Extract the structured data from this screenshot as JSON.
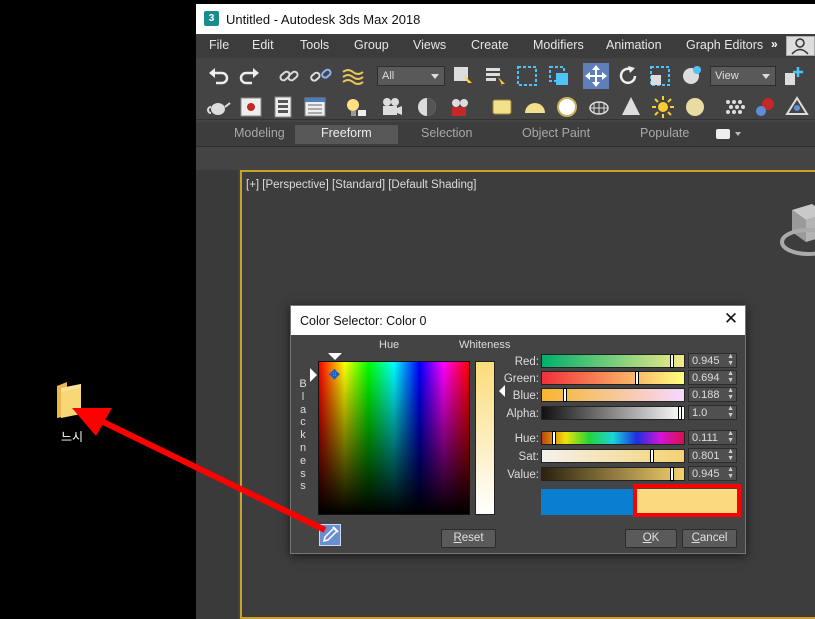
{
  "desktop": {
    "folder_label": "느시"
  },
  "window": {
    "logo": "3",
    "title": "Untitled - Autodesk 3ds Max 2018"
  },
  "menu": {
    "items": [
      "File",
      "Edit",
      "Tools",
      "Group",
      "Views",
      "Create",
      "Modifiers",
      "Animation",
      "Graph Editors"
    ],
    "more": "»"
  },
  "toolbar": {
    "selection_filter": "All",
    "coord_system": "View",
    "icons_row1": [
      "undo-icon",
      "redo-icon",
      "link-icon",
      "unlink-icon",
      "bind-space-warp-icon",
      "select-object-icon",
      "select-by-name-icon",
      "rectangular-selection-icon",
      "window-crossing-icon",
      "move-icon",
      "rotate-icon",
      "scale-icon",
      "placement-icon"
    ],
    "icons_row2": [
      "teapot-icon",
      "render-frame-icon",
      "material-editor-icon",
      "schematic-icon",
      "light-lister-icon",
      "camera-icon",
      "render-icon",
      "render-setup-icon",
      "box-icon",
      "sphere-icon",
      "cylinder-icon",
      "torus-icon",
      "cone-icon",
      "sun-icon",
      "geosphere-icon",
      "particle-icon",
      "atom-icon",
      "helper-icon"
    ]
  },
  "ribbon": {
    "tabs": [
      "Modeling",
      "Freeform",
      "Selection",
      "Object Paint",
      "Populate"
    ],
    "active_tab": "Freeform"
  },
  "viewport": {
    "label": "[+] [Perspective] [Standard] [Default Shading]"
  },
  "color_selector": {
    "title": "Color Selector: Color 0",
    "hue_label": "Hue",
    "whiteness_label": "Whiteness",
    "blackness_label": [
      "B",
      "l",
      "a",
      "c",
      "k",
      "n",
      "e",
      "s",
      "s"
    ],
    "channels": [
      {
        "label": "Red:",
        "value": "0.945",
        "level": 0.945
      },
      {
        "label": "Green:",
        "value": "0.694",
        "level": 0.694
      },
      {
        "label": "Blue:",
        "value": "0.188",
        "level": 0.188
      },
      {
        "label": "Alpha:",
        "value": "1.0",
        "level": 1.0
      },
      {
        "label": "Hue:",
        "value": "0.111",
        "level": 0.111
      },
      {
        "label": "Sat:",
        "value": "0.801",
        "level": 0.801
      },
      {
        "label": "Value:",
        "value": "0.945",
        "level": 0.945
      }
    ],
    "old_color": "#0a7fd1",
    "new_color": "#fad97f",
    "reset_label": "Reset",
    "ok_label": "OK",
    "cancel_label": "Cancel"
  },
  "colors": {
    "viewport_border": "#c9a227",
    "highlight": "#ff0000"
  }
}
